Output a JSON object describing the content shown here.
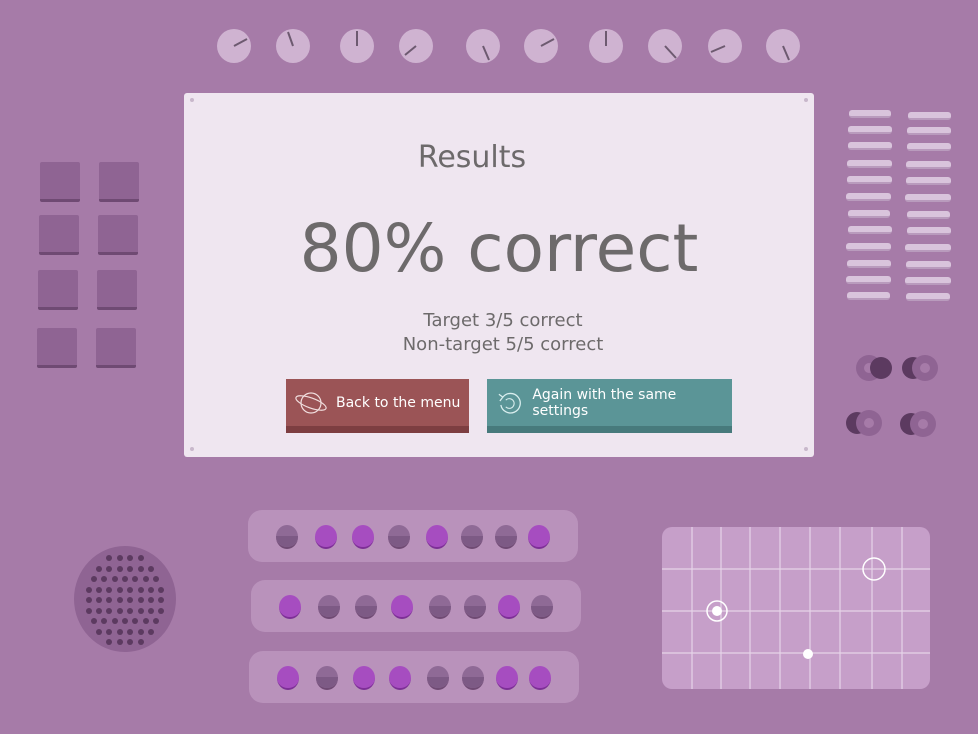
{
  "results": {
    "title": "Results",
    "score": "80% correct",
    "target_line": "Target 3/5 correct",
    "nontarget_line": "Non-target 5/5 correct"
  },
  "buttons": {
    "back_label": "Back to the menu",
    "again_label": "Again with the same settings"
  },
  "decor": {
    "knob_count": 10,
    "pad_count": 8,
    "toggle_count": 4,
    "row_pattern": [
      [
        "off",
        "on",
        "on",
        "off",
        "on",
        "off",
        "off",
        "on"
      ],
      [
        "on",
        "off",
        "off",
        "on",
        "off",
        "off",
        "on",
        "off"
      ],
      [
        "on",
        "off",
        "on",
        "on",
        "off",
        "off",
        "on",
        "on"
      ]
    ]
  },
  "colors": {
    "background": "#a67ba8",
    "panel": "#efe6f0",
    "back_button": "#9b5456",
    "again_button": "#5b9597",
    "text": "#6d6a6b"
  },
  "icons": {
    "back": "planet-icon",
    "again": "refresh-icon"
  }
}
